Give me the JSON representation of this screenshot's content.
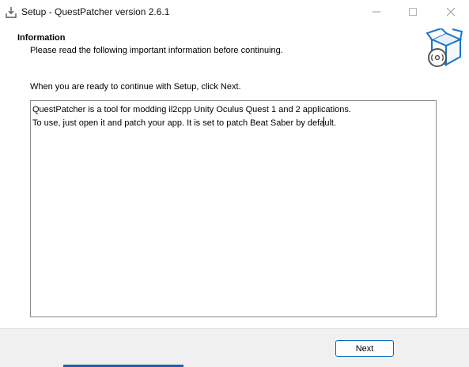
{
  "window": {
    "title": "Setup - QuestPatcher version 2.6.1",
    "icons": {
      "app": "setup-download-icon",
      "minimize": "minimize-icon",
      "maximize": "maximize-icon",
      "close": "close-icon"
    }
  },
  "header": {
    "title": "Information",
    "subtitle": "Please read the following important information before continuing.",
    "icon": "installer-box-icon"
  },
  "instruction": "When you are ready to continue with Setup, click Next.",
  "info": {
    "line1": "QuestPatcher is a tool for modding il2cpp Unity Oculus Quest 1 and 2 applications.",
    "line2_before_caret": "To use, just open it and patch your app. It is set to patch Beat Saber by defa",
    "line2_after_caret": "ult."
  },
  "footer": {
    "next_label": "Next"
  },
  "colors": {
    "accent": "#0067c0",
    "footer_bg": "#f0f0f0",
    "taskbar_accent": "#1c5fb0"
  }
}
